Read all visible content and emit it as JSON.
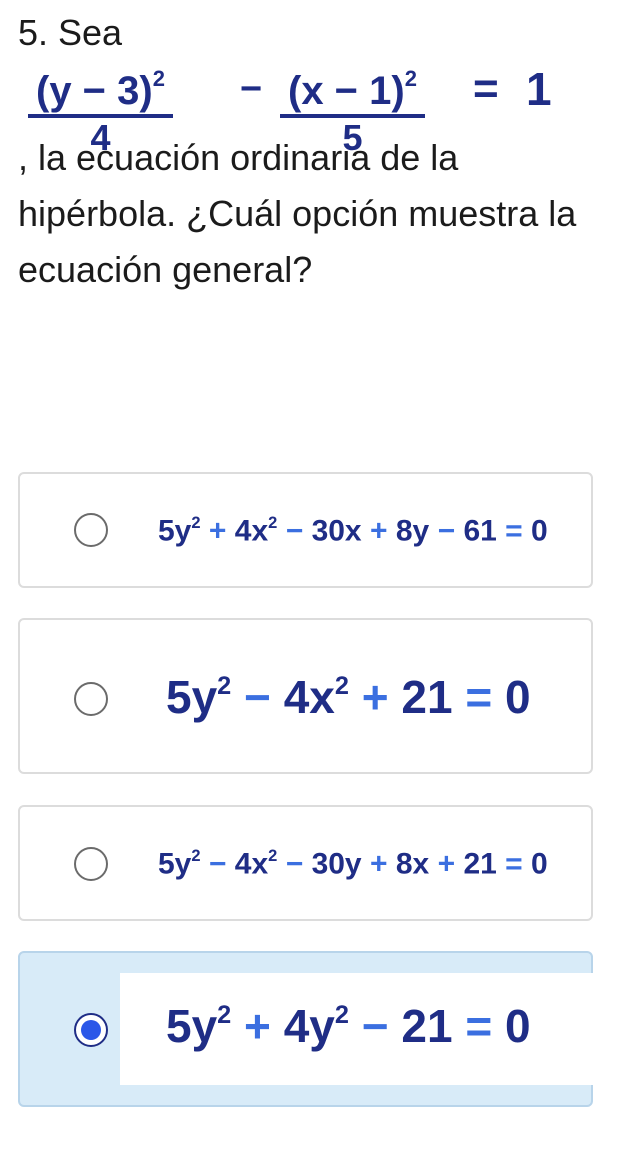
{
  "question": {
    "number_title": "5. Sea",
    "formula": {
      "num1": "(y − 3)",
      "den1": "4",
      "num2": "(x − 1)",
      "den2": "5",
      "exp": "2",
      "minus": "−",
      "equals": "=",
      "rhs": "1"
    },
    "text": ", la ecuación ordinaria de la hipérbola. ¿Cuál opción muestra la ecuación general?"
  },
  "options": [
    {
      "selected": false,
      "terms": [
        "5y",
        "+",
        "4x",
        "−",
        "30x",
        "+",
        "8y",
        "−",
        "61",
        "=",
        "0"
      ]
    },
    {
      "selected": false,
      "terms": [
        "5y",
        "−",
        "4x",
        "+",
        "21",
        "=",
        "0"
      ]
    },
    {
      "selected": false,
      "terms": [
        "5y",
        "−",
        "4x",
        "−",
        "30y",
        "+",
        "8x",
        "+",
        "21",
        "=",
        "0"
      ]
    },
    {
      "selected": true,
      "terms": [
        "5y",
        "+",
        "4y",
        "−",
        "21",
        "=",
        "0"
      ]
    }
  ],
  "colors": {
    "math": "#1f2d86",
    "operator": "#3b6fe0",
    "selected_bg": "#d8ebf8",
    "radio_fill": "#2a57e8"
  }
}
